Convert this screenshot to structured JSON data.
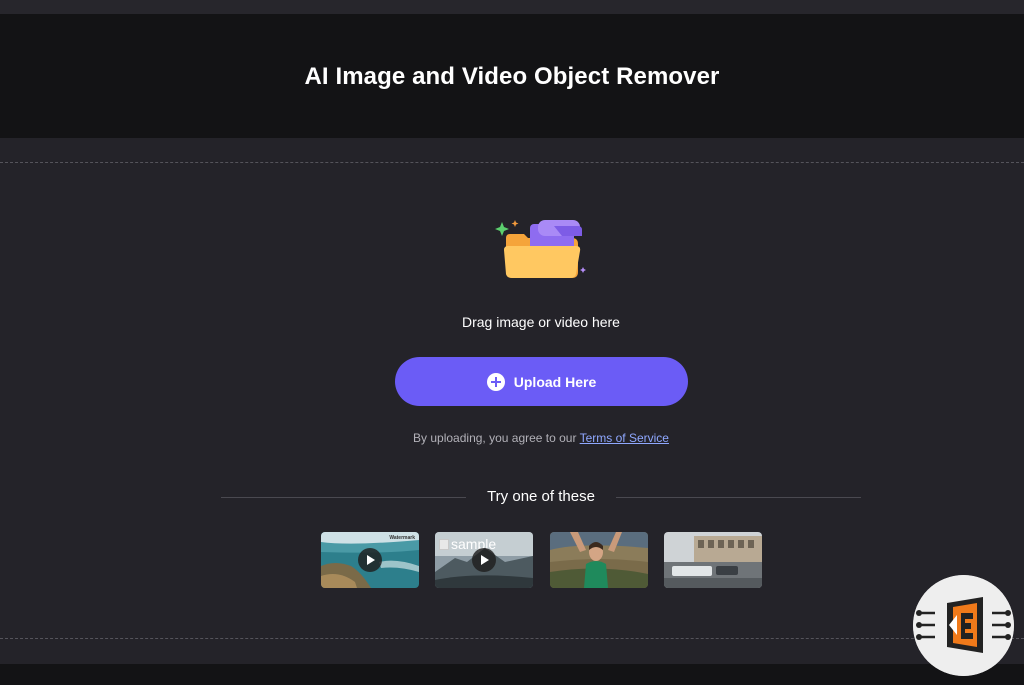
{
  "header": {
    "title": "AI Image and Video Object Remover"
  },
  "upload": {
    "drag_text": "Drag image or video here",
    "button_label": "Upload Here",
    "agree_prefix": "By uploading, you agree to our",
    "terms_link": "Terms of Service"
  },
  "samples": {
    "heading": "Try one of these",
    "items": [
      {
        "kind": "video",
        "watermark": "Watermark"
      },
      {
        "kind": "video",
        "alt_text": "sample"
      },
      {
        "kind": "image"
      },
      {
        "kind": "image"
      }
    ]
  },
  "colors": {
    "accent": "#6b5cf6",
    "link": "#8fa8ff",
    "background": "#242329",
    "hero_background": "#131315",
    "badge_accent": "#f07a1a"
  },
  "icons": {
    "folder": "folder-upload-icon",
    "plus": "plus-circle-icon",
    "play": "play-icon",
    "badge": "logo-badge-icon"
  }
}
